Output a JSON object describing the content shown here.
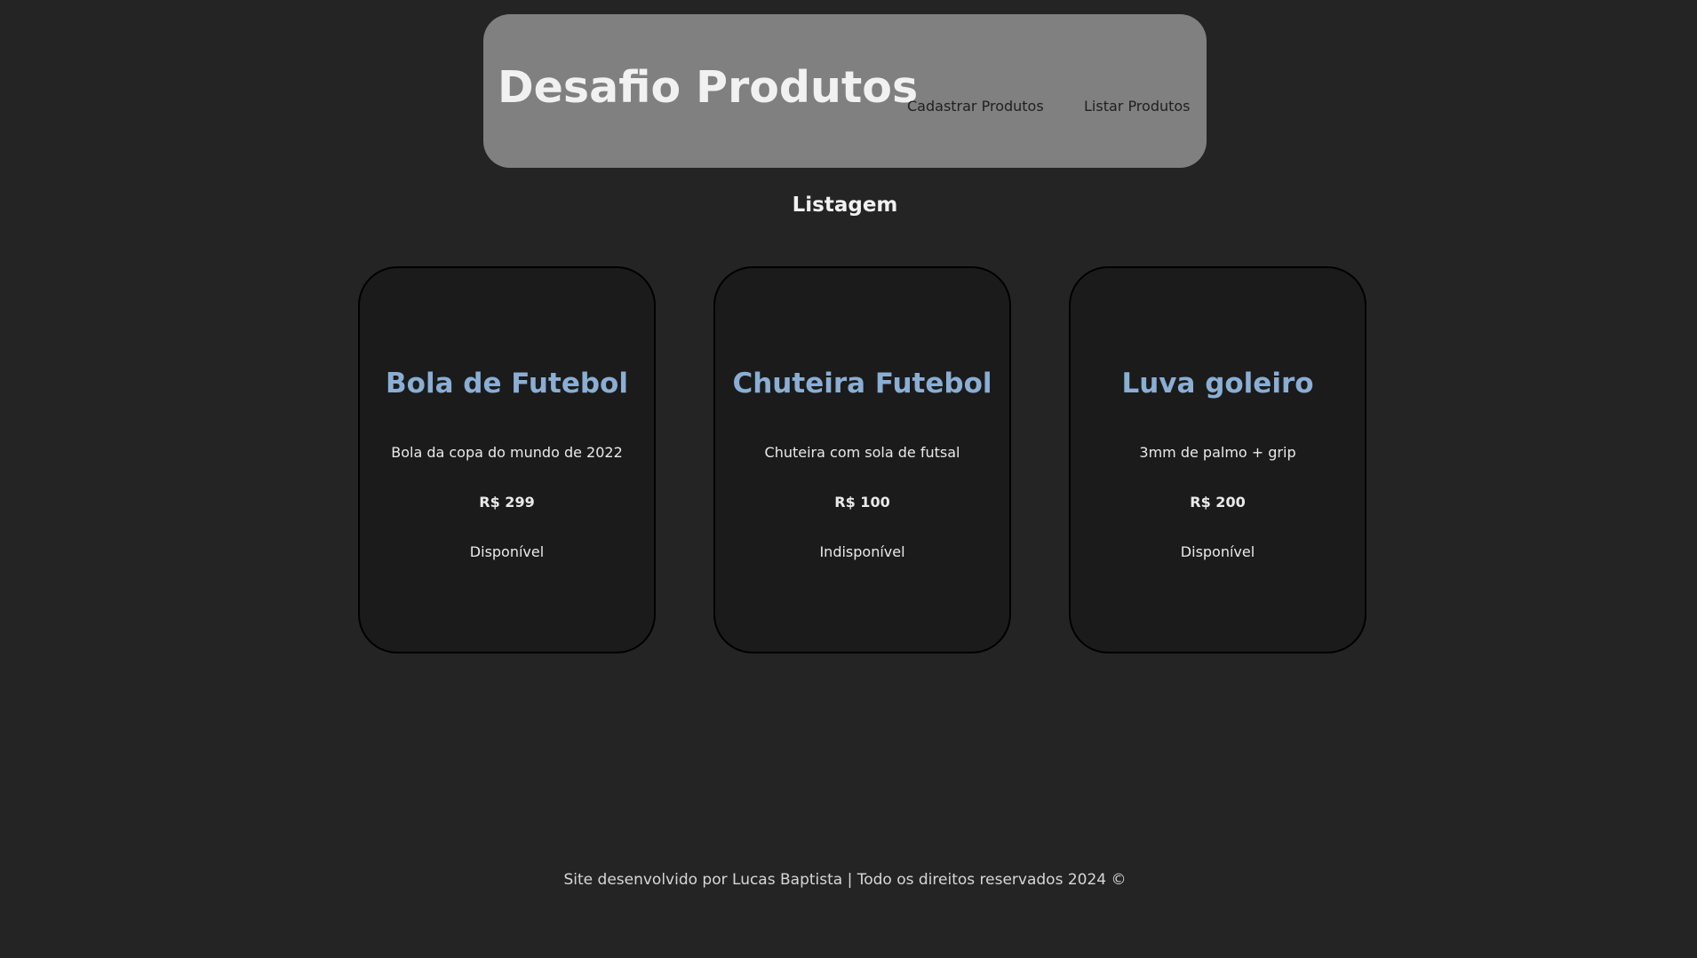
{
  "header": {
    "brand": "Desafio Produtos",
    "nav": {
      "cadastrar": "Cadastrar Produtos",
      "listar": "Listar Produtos"
    }
  },
  "main": {
    "section_title": "Listagem",
    "products": [
      {
        "name": "Bola de Futebol",
        "description": "Bola da copa do mundo de 2022",
        "price": "R$ 299",
        "status": "Disponível"
      },
      {
        "name": "Chuteira Futebol",
        "description": "Chuteira com sola de futsal",
        "price": "R$ 100",
        "status": "Indisponível"
      },
      {
        "name": "Luva goleiro",
        "description": "3mm de palmo + grip",
        "price": "R$ 200",
        "status": "Disponível"
      }
    ]
  },
  "footer": {
    "text": "Site desenvolvido por Lucas Baptista | Todo os direitos reservados 2024 ©"
  },
  "colors": {
    "background": "#242424",
    "header_bg": "#808080",
    "card_bg": "#1b1b1b",
    "card_title": "#8aaed4"
  }
}
